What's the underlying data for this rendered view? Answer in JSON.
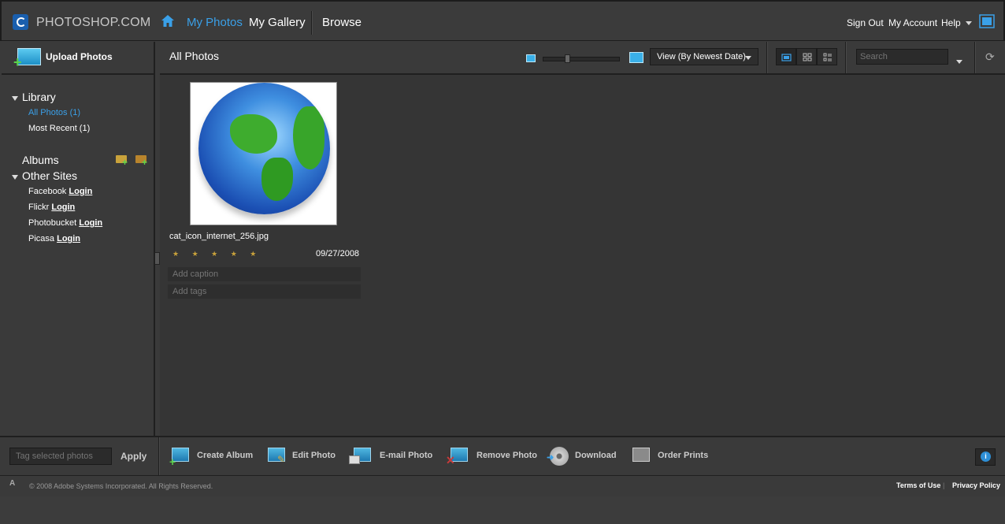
{
  "brand": {
    "name": "PHOTOSHOP.COM"
  },
  "nav": {
    "my_photos": "My Photos",
    "my_gallery": "My Gallery",
    "browse": "Browse"
  },
  "account": {
    "sign_out": "Sign Out",
    "my_account": "My Account",
    "help": "Help"
  },
  "sidebar": {
    "upload": "Upload Photos",
    "library": "Library",
    "all_photos": "All Photos (1)",
    "most_recent": "Most Recent (1)",
    "albums": "Albums",
    "other_sites": "Other Sites",
    "sites": [
      {
        "name": "Facebook",
        "action": "Login"
      },
      {
        "name": "Flickr",
        "action": "Login"
      },
      {
        "name": "Photobucket",
        "action": "Login"
      },
      {
        "name": "Picasa",
        "action": "Login"
      }
    ]
  },
  "main": {
    "title": "All Photos",
    "view_select": "View (By Newest Date)",
    "search_placeholder": "Search"
  },
  "photo": {
    "filename": "cat_icon_internet_256.jpg",
    "stars": "★ ★ ★ ★ ★",
    "date": "09/27/2008",
    "caption_placeholder": "Add caption",
    "tags_placeholder": "Add tags"
  },
  "toolbar": {
    "tag_placeholder": "Tag selected photos",
    "apply": "Apply",
    "create_album": "Create Album",
    "edit_photo": "Edit Photo",
    "email_photo": "E-mail Photo",
    "remove_photo": "Remove Photo",
    "download": "Download",
    "order_prints": "Order Prints"
  },
  "footer": {
    "copyright": "© 2008 Adobe Systems Incorporated. All Rights Reserved.",
    "terms": "Terms of Use",
    "sep": "|",
    "privacy": "Privacy Policy"
  },
  "colors": {
    "accent": "#3aa0e8",
    "background": "#3a3a3a",
    "content_bg": "#353535"
  }
}
